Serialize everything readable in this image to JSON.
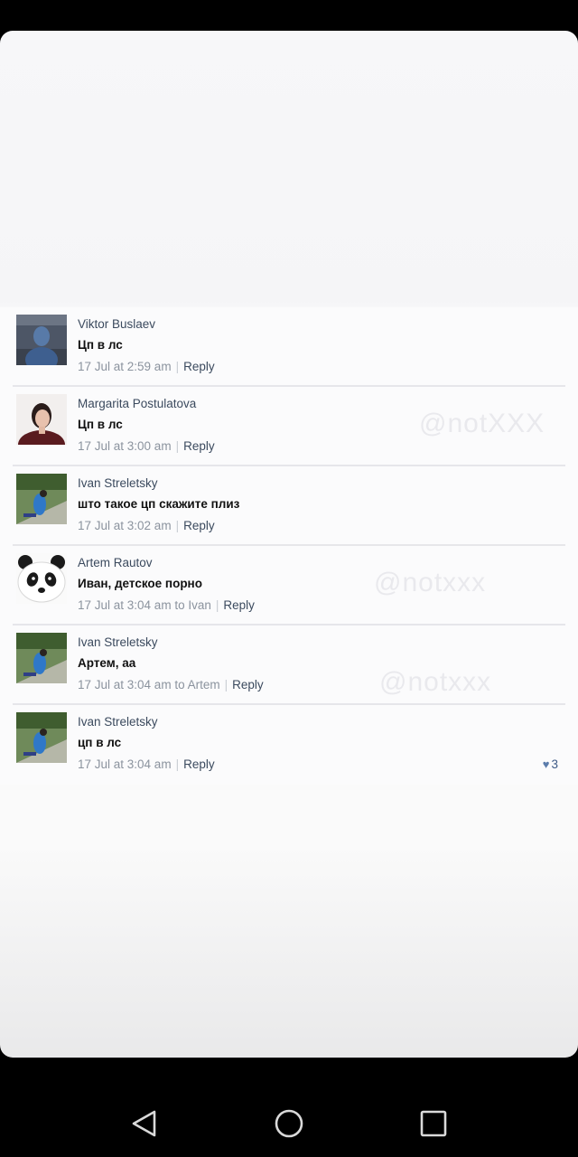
{
  "comments": [
    {
      "author": "Viktor Buslaev",
      "text": "Цп в лс",
      "time": "17 Jul at 2:59 am",
      "reply": "Reply",
      "avatar": "person-hood-avatar"
    },
    {
      "author": "Margarita Postulatova",
      "text": "Цп в лс",
      "time": "17 Jul at 3:00 am",
      "reply": "Reply",
      "avatar": "woman-portrait-avatar"
    },
    {
      "author": "Ivan Streletsky",
      "text": "што такое цп скажите плиз",
      "time": "17 Jul at 3:02 am",
      "reply": "Reply",
      "avatar": "outdoor-photo-avatar"
    },
    {
      "author": "Artem Rautov",
      "text": "Иван, детское порно",
      "time": "17 Jul at 3:04 am to Ivan",
      "reply": "Reply",
      "avatar": "panda-avatar"
    },
    {
      "author": "Ivan Streletsky",
      "text": "Артем, аа",
      "time": "17 Jul at 3:04 am to Artem",
      "reply": "Reply",
      "avatar": "outdoor-photo-avatar"
    },
    {
      "author": "Ivan Streletsky",
      "text": "цп в лс",
      "time": "17 Jul at 3:04 am",
      "reply": "Reply",
      "likes": "3",
      "avatar": "outdoor-photo-avatar"
    }
  ],
  "watermarks": [
    "@notXXX",
    "@notxxx",
    "@notxxx"
  ],
  "nav": {
    "back": "back-icon",
    "home": "home-icon",
    "recents": "recents-icon"
  }
}
